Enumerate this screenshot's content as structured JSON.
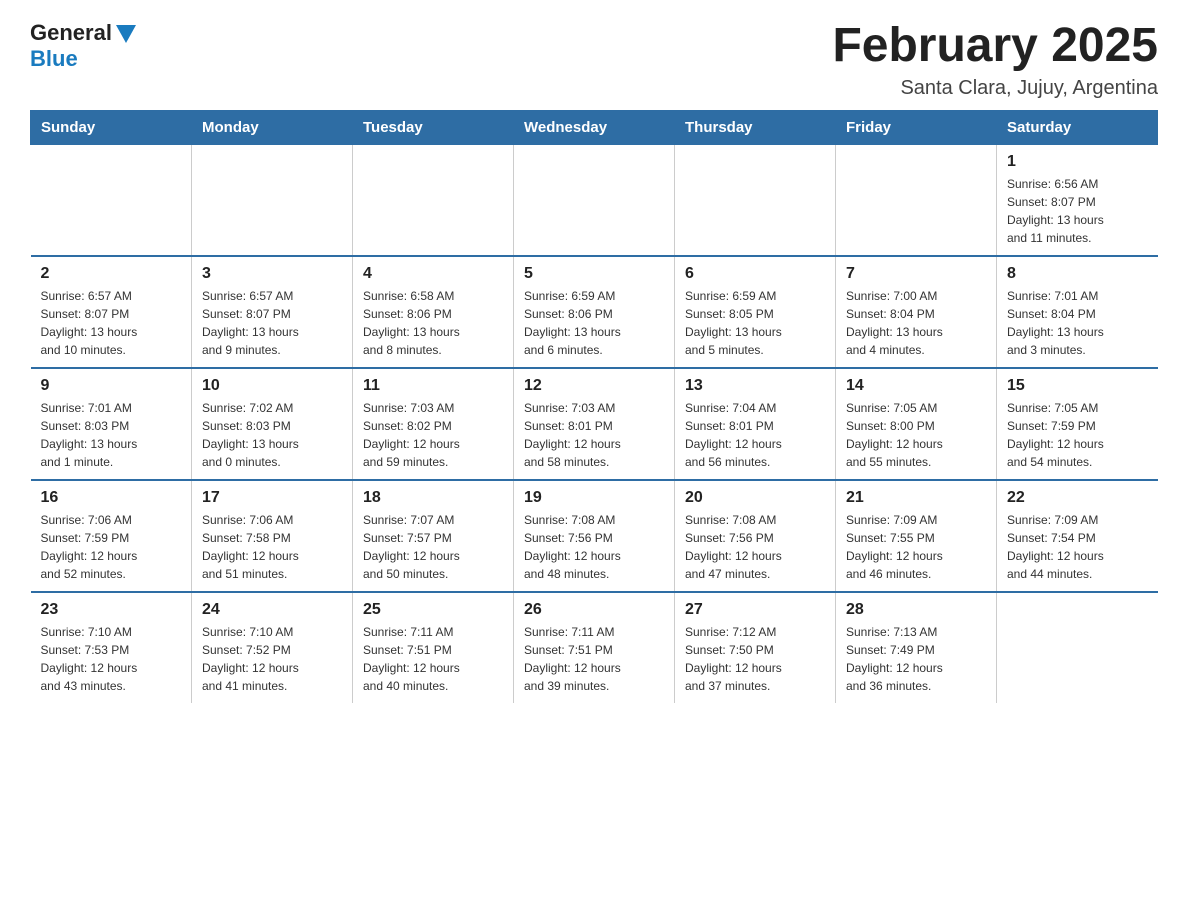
{
  "logo": {
    "general": "General",
    "blue": "Blue"
  },
  "title": "February 2025",
  "location": "Santa Clara, Jujuy, Argentina",
  "weekdays": [
    "Sunday",
    "Monday",
    "Tuesday",
    "Wednesday",
    "Thursday",
    "Friday",
    "Saturday"
  ],
  "weeks": [
    [
      {
        "day": "",
        "info": ""
      },
      {
        "day": "",
        "info": ""
      },
      {
        "day": "",
        "info": ""
      },
      {
        "day": "",
        "info": ""
      },
      {
        "day": "",
        "info": ""
      },
      {
        "day": "",
        "info": ""
      },
      {
        "day": "1",
        "info": "Sunrise: 6:56 AM\nSunset: 8:07 PM\nDaylight: 13 hours\nand 11 minutes."
      }
    ],
    [
      {
        "day": "2",
        "info": "Sunrise: 6:57 AM\nSunset: 8:07 PM\nDaylight: 13 hours\nand 10 minutes."
      },
      {
        "day": "3",
        "info": "Sunrise: 6:57 AM\nSunset: 8:07 PM\nDaylight: 13 hours\nand 9 minutes."
      },
      {
        "day": "4",
        "info": "Sunrise: 6:58 AM\nSunset: 8:06 PM\nDaylight: 13 hours\nand 8 minutes."
      },
      {
        "day": "5",
        "info": "Sunrise: 6:59 AM\nSunset: 8:06 PM\nDaylight: 13 hours\nand 6 minutes."
      },
      {
        "day": "6",
        "info": "Sunrise: 6:59 AM\nSunset: 8:05 PM\nDaylight: 13 hours\nand 5 minutes."
      },
      {
        "day": "7",
        "info": "Sunrise: 7:00 AM\nSunset: 8:04 PM\nDaylight: 13 hours\nand 4 minutes."
      },
      {
        "day": "8",
        "info": "Sunrise: 7:01 AM\nSunset: 8:04 PM\nDaylight: 13 hours\nand 3 minutes."
      }
    ],
    [
      {
        "day": "9",
        "info": "Sunrise: 7:01 AM\nSunset: 8:03 PM\nDaylight: 13 hours\nand 1 minute."
      },
      {
        "day": "10",
        "info": "Sunrise: 7:02 AM\nSunset: 8:03 PM\nDaylight: 13 hours\nand 0 minutes."
      },
      {
        "day": "11",
        "info": "Sunrise: 7:03 AM\nSunset: 8:02 PM\nDaylight: 12 hours\nand 59 minutes."
      },
      {
        "day": "12",
        "info": "Sunrise: 7:03 AM\nSunset: 8:01 PM\nDaylight: 12 hours\nand 58 minutes."
      },
      {
        "day": "13",
        "info": "Sunrise: 7:04 AM\nSunset: 8:01 PM\nDaylight: 12 hours\nand 56 minutes."
      },
      {
        "day": "14",
        "info": "Sunrise: 7:05 AM\nSunset: 8:00 PM\nDaylight: 12 hours\nand 55 minutes."
      },
      {
        "day": "15",
        "info": "Sunrise: 7:05 AM\nSunset: 7:59 PM\nDaylight: 12 hours\nand 54 minutes."
      }
    ],
    [
      {
        "day": "16",
        "info": "Sunrise: 7:06 AM\nSunset: 7:59 PM\nDaylight: 12 hours\nand 52 minutes."
      },
      {
        "day": "17",
        "info": "Sunrise: 7:06 AM\nSunset: 7:58 PM\nDaylight: 12 hours\nand 51 minutes."
      },
      {
        "day": "18",
        "info": "Sunrise: 7:07 AM\nSunset: 7:57 PM\nDaylight: 12 hours\nand 50 minutes."
      },
      {
        "day": "19",
        "info": "Sunrise: 7:08 AM\nSunset: 7:56 PM\nDaylight: 12 hours\nand 48 minutes."
      },
      {
        "day": "20",
        "info": "Sunrise: 7:08 AM\nSunset: 7:56 PM\nDaylight: 12 hours\nand 47 minutes."
      },
      {
        "day": "21",
        "info": "Sunrise: 7:09 AM\nSunset: 7:55 PM\nDaylight: 12 hours\nand 46 minutes."
      },
      {
        "day": "22",
        "info": "Sunrise: 7:09 AM\nSunset: 7:54 PM\nDaylight: 12 hours\nand 44 minutes."
      }
    ],
    [
      {
        "day": "23",
        "info": "Sunrise: 7:10 AM\nSunset: 7:53 PM\nDaylight: 12 hours\nand 43 minutes."
      },
      {
        "day": "24",
        "info": "Sunrise: 7:10 AM\nSunset: 7:52 PM\nDaylight: 12 hours\nand 41 minutes."
      },
      {
        "day": "25",
        "info": "Sunrise: 7:11 AM\nSunset: 7:51 PM\nDaylight: 12 hours\nand 40 minutes."
      },
      {
        "day": "26",
        "info": "Sunrise: 7:11 AM\nSunset: 7:51 PM\nDaylight: 12 hours\nand 39 minutes."
      },
      {
        "day": "27",
        "info": "Sunrise: 7:12 AM\nSunset: 7:50 PM\nDaylight: 12 hours\nand 37 minutes."
      },
      {
        "day": "28",
        "info": "Sunrise: 7:13 AM\nSunset: 7:49 PM\nDaylight: 12 hours\nand 36 minutes."
      },
      {
        "day": "",
        "info": ""
      }
    ]
  ]
}
